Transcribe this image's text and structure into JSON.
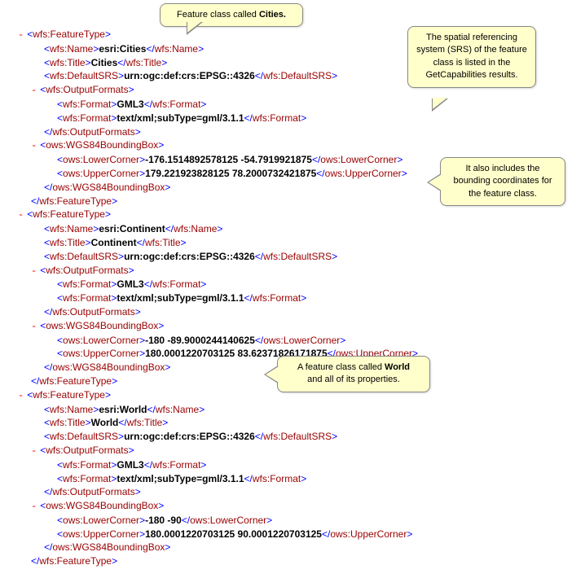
{
  "callouts": {
    "c1_pre": "Feature class called ",
    "c1_b": "Cities.",
    "c2": "The spatial referencing system (SRS) of the feature class is listed in the GetCapabilities results.",
    "c3": "It also includes the bounding coordinates for the feature class.",
    "c4_pre": "A feature class called ",
    "c4_b": "World",
    "c4_post": " and all of its properties."
  },
  "toggle": "-",
  "xml": {
    "featureTypeOpen": "wfs:FeatureType",
    "featureTypeClose": "wfs:FeatureType",
    "nameTag": "wfs:Name",
    "titleTag": "wfs:Title",
    "defaultSrsTag": "wfs:DefaultSRS",
    "outputFormatsTag": "wfs:OutputFormats",
    "formatTag": "wfs:Format",
    "bboxTag": "ows:WGS84BoundingBox",
    "lowerTag": "ows:LowerCorner",
    "upperTag": "ows:UpperCorner",
    "fmt1": "GML3",
    "fmt2": "text/xml;subType=gml/3.1.1",
    "srs": "urn:ogc:def:crs:EPSG::4326",
    "f1": {
      "name": "esri:Cities",
      "title": "Cities",
      "lower": "-176.1514892578125 -54.7919921875",
      "upper": "179.221923828125 78.2000732421875"
    },
    "f2": {
      "name": "esri:Continent",
      "title": "Continent",
      "lower": "-180 -89.9000244140625",
      "upper": "180.0001220703125 83.62371826171875"
    },
    "f3": {
      "name": "esri:World",
      "title": "World",
      "lower": "-180 -90",
      "upper": "180.0001220703125 90.0001220703125"
    }
  }
}
